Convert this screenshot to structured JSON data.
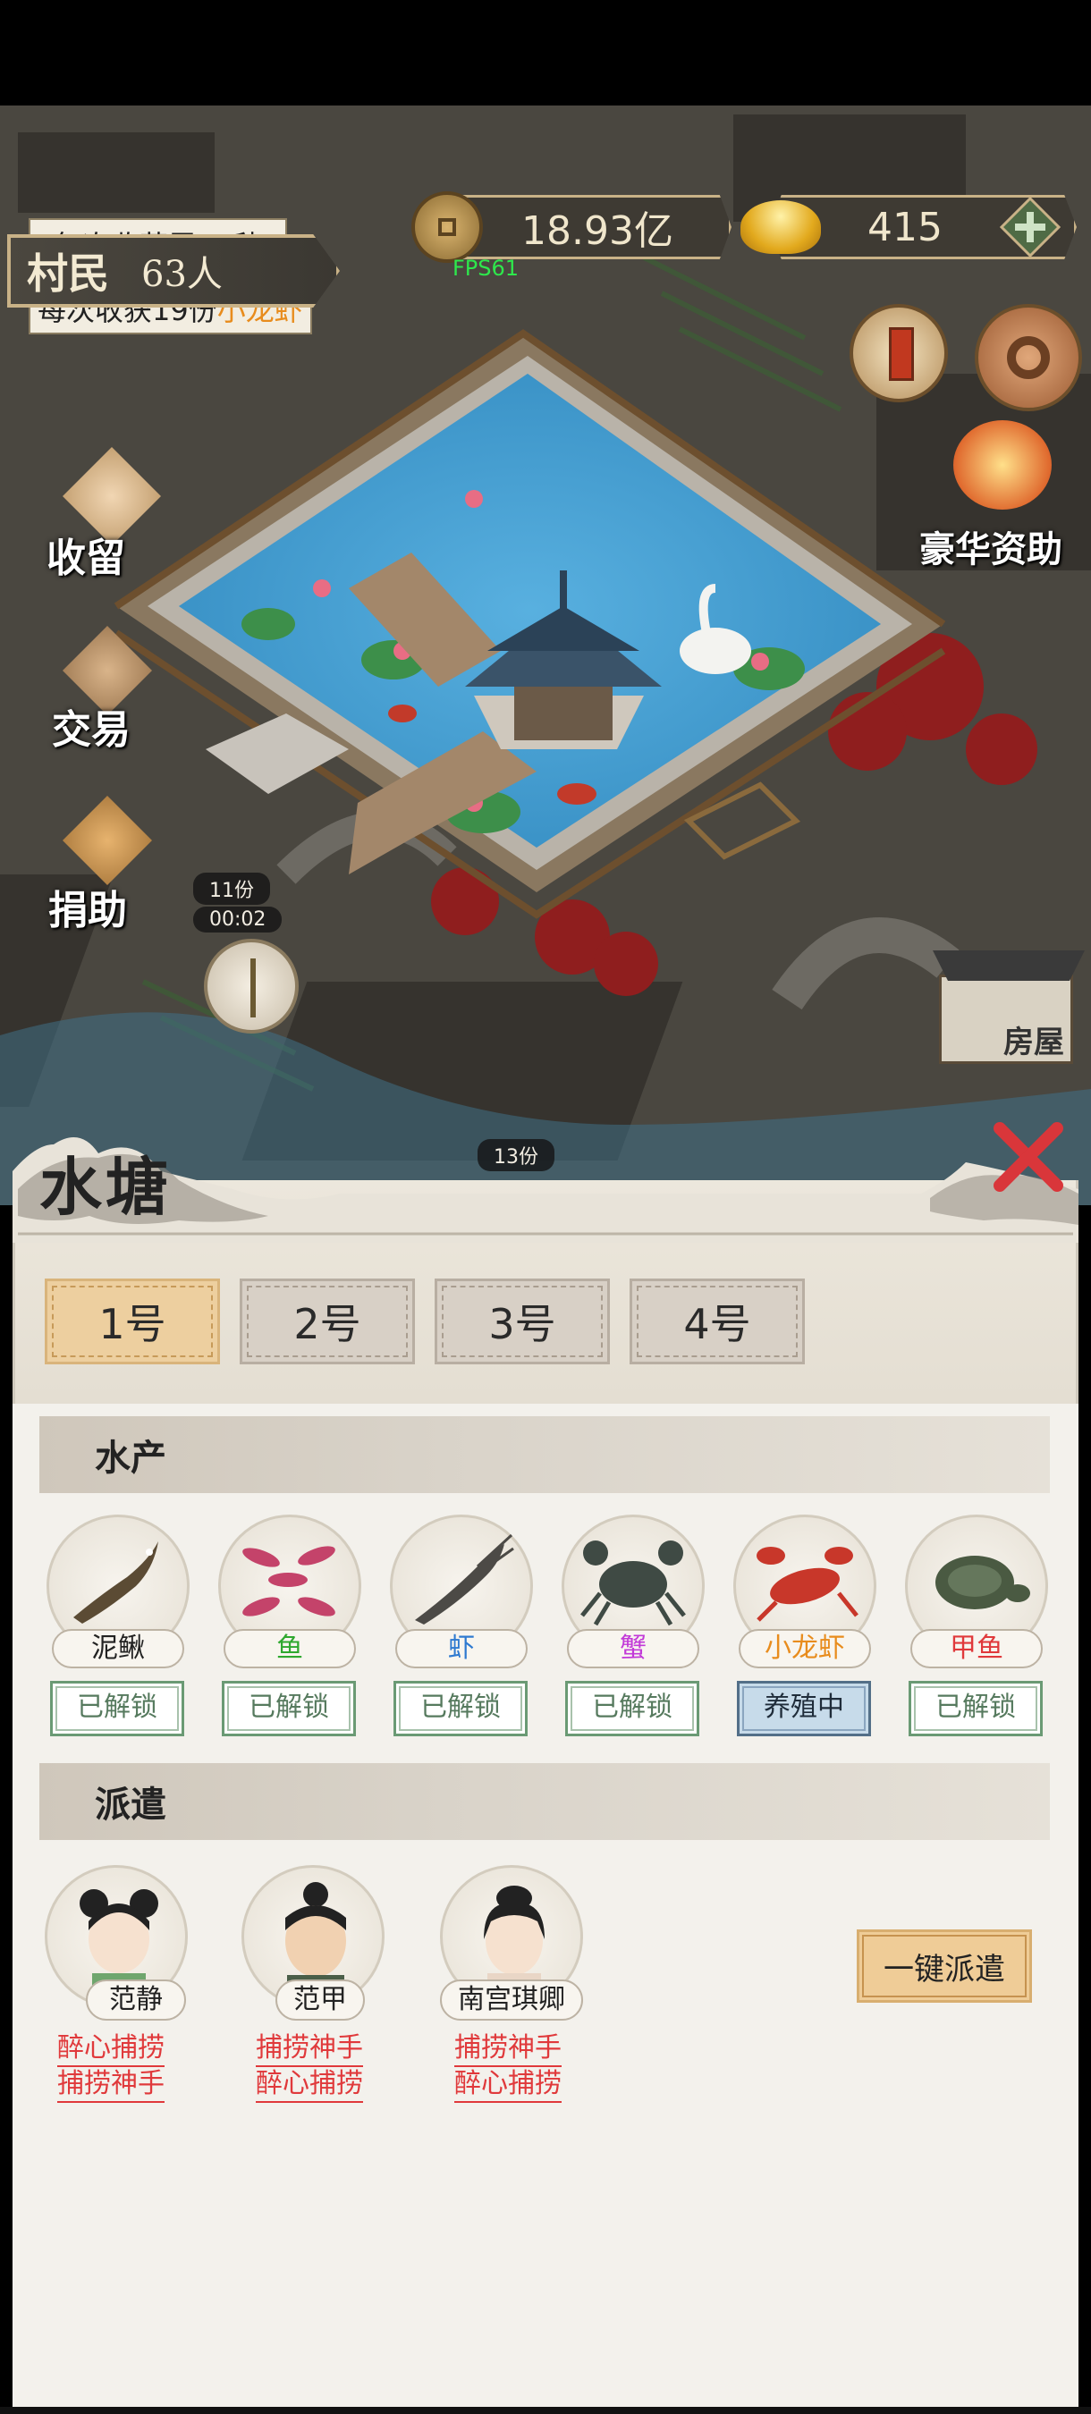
{
  "hud": {
    "harvest_time": "每次收获需56秒",
    "harvest_amount_prefix": "每次收获19份",
    "harvest_item": "小龙虾",
    "villager_label": "村民",
    "villager_count": "63人",
    "coins": "18.93亿",
    "gold": "415",
    "fps": "FPS61"
  },
  "side_menu": {
    "shelter": "收留",
    "trade": "交易",
    "donate": "捐助",
    "luxury_aid": "豪华资助",
    "house": "房屋"
  },
  "map_timers": [
    {
      "count": "11份",
      "time": "00:02"
    },
    {
      "count": "13份",
      "time": ""
    }
  ],
  "panel": {
    "title": "水塘",
    "tabs": [
      "1号",
      "2号",
      "3号",
      "4号"
    ],
    "active_tab": 0,
    "aquatic_section": "水产",
    "dispatch_section": "派遣",
    "species": [
      {
        "name": "泥鳅",
        "status": "已解锁",
        "name_color": "#222222",
        "icon": "loach-icon"
      },
      {
        "name": "鱼",
        "status": "已解锁",
        "name_color": "#2fa82f",
        "icon": "fish-icon"
      },
      {
        "name": "虾",
        "status": "已解锁",
        "name_color": "#2f7ad0",
        "icon": "shrimp-icon"
      },
      {
        "name": "蟹",
        "status": "已解锁",
        "name_color": "#c23ad8",
        "icon": "crab-icon"
      },
      {
        "name": "小龙虾",
        "status": "养殖中",
        "name_color": "#e88c1d",
        "icon": "crayfish-icon"
      },
      {
        "name": "甲鱼",
        "status": "已解锁",
        "name_color": "#e0393b",
        "icon": "turtle-icon"
      }
    ],
    "characters": [
      {
        "name": "范静",
        "traits": [
          "醉心捕捞",
          "捕捞神手"
        ]
      },
      {
        "name": "范甲",
        "traits": [
          "捕捞神手",
          "醉心捕捞"
        ]
      },
      {
        "name": "南宫琪卿",
        "traits": [
          "捕捞神手",
          "醉心捕捞"
        ]
      }
    ],
    "dispatch_all": "一键派遣"
  },
  "colors": {
    "trait_red": "#e0393b",
    "tab_active": "#edcf9f",
    "unlocked_green": "#567a5e",
    "breeding_blue": "#c7dbea"
  }
}
